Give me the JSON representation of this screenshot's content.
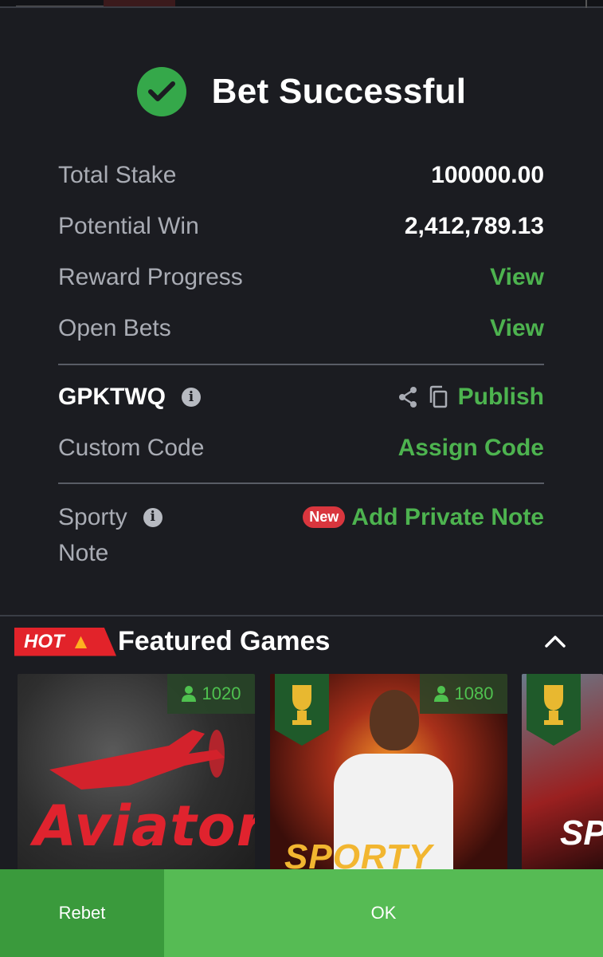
{
  "header": {
    "title": "Bet Successful"
  },
  "summary": {
    "total_stake_label": "Total Stake",
    "total_stake_value": "100000.00",
    "potential_win_label": "Potential Win",
    "potential_win_value": "2,412,789.13",
    "reward_progress_label": "Reward Progress",
    "reward_progress_link": "View",
    "open_bets_label": "Open Bets",
    "open_bets_link": "View"
  },
  "booking": {
    "code": "GPKTWQ",
    "publish_label": "Publish",
    "custom_code_label": "Custom Code",
    "assign_code_label": "Assign Code"
  },
  "note": {
    "label_line1": "Sporty",
    "label_line2": "Note",
    "new_badge": "New",
    "add_note_label": "Add Private Note"
  },
  "featured": {
    "hot_label": "HOT",
    "title": "Featured Games",
    "games": [
      {
        "name": "Aviator",
        "players": "1020"
      },
      {
        "name": "SPORTY HERO",
        "players": "1080"
      },
      {
        "name": "SPR"
      }
    ]
  },
  "footer": {
    "rebet_label": "Rebet",
    "ok_label": "OK"
  },
  "colors": {
    "accent_green": "#4db34f",
    "success_green": "#35a84a",
    "hot_red": "#e2232a",
    "background": "#1b1c21"
  }
}
